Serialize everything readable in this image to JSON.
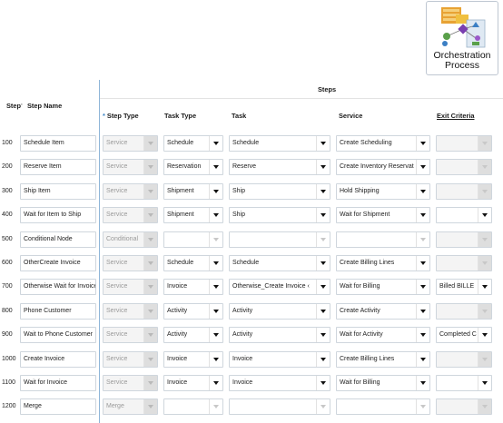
{
  "orchestration_icon": {
    "label_line1": "Orchestration",
    "label_line2": "Process",
    "icon": "orchestration-process-icon"
  },
  "headers": {
    "step": "Step",
    "step_mark": "'",
    "step_name": "Step Name",
    "group": "Steps",
    "required_marker": "*",
    "step_type": "Step Type",
    "task_type": "Task Type",
    "task": "Task",
    "service": "Service",
    "exit_criteria": "Exit Criteria"
  },
  "rows": [
    {
      "step": "100",
      "name": "Schedule Item",
      "step_type": "Service",
      "task_type": "Schedule",
      "task": "Schedule",
      "service": "Create Scheduling",
      "exit": ""
    },
    {
      "step": "200",
      "name": "Reserve Item",
      "step_type": "Service",
      "task_type": "Reservation",
      "task": "Reserve",
      "service": "Create Inventory Reservat",
      "exit": ""
    },
    {
      "step": "300",
      "name": "Ship Item",
      "step_type": "Service",
      "task_type": "Shipment",
      "task": "Ship",
      "service": "Hold Shipping",
      "exit": ""
    },
    {
      "step": "400",
      "name": "Wait for Item to Ship",
      "step_type": "Service",
      "task_type": "Shipment",
      "task": "Ship",
      "service": "Wait for Shipment",
      "exit": ""
    },
    {
      "step": "500",
      "name": "Conditional Node",
      "step_type": "Conditional",
      "task_type": "",
      "task": "",
      "service": "",
      "exit": ""
    },
    {
      "step": "600",
      "name": "OtherCreate Invoice",
      "step_type": "Service",
      "task_type": "Schedule",
      "task": "Schedule",
      "service": "Create Billing Lines",
      "exit": ""
    },
    {
      "step": "700",
      "name": "Otherwise Wait for Invoice",
      "step_type": "Service",
      "task_type": "Invoice",
      "task": "Otherwise_Create Invoice ‹",
      "service": "Wait for Billing",
      "exit": "Billed BILLE"
    },
    {
      "step": "800",
      "name": "Phone Customer",
      "step_type": "Service",
      "task_type": "Activity",
      "task": "Activity",
      "service": "Create Activity",
      "exit": ""
    },
    {
      "step": "900",
      "name": "Wait to Phone Customer",
      "step_type": "Service",
      "task_type": "Activity",
      "task": "Activity",
      "service": "Wait for Activity",
      "exit": "Completed C"
    },
    {
      "step": "1000",
      "name": "Create Invoice",
      "step_type": "Service",
      "task_type": "Invoice",
      "task": "Invoice",
      "service": "Create Billing Lines",
      "exit": ""
    },
    {
      "step": "1100",
      "name": "Wait for Invoice",
      "step_type": "Service",
      "task_type": "Invoice",
      "task": "Invoice",
      "service": "Wait for Billing",
      "exit": ""
    },
    {
      "step": "1200",
      "name": "Merge",
      "step_type": "Merge",
      "task_type": "",
      "task": "",
      "service": "",
      "exit": ""
    }
  ],
  "row_states": [
    {
      "dis": false,
      "exit_dis": true
    },
    {
      "dis": false,
      "exit_dis": true
    },
    {
      "dis": false,
      "exit_dis": true
    },
    {
      "dis": false,
      "exit_dis": false
    },
    {
      "dis": true,
      "exit_dis": true
    },
    {
      "dis": false,
      "exit_dis": true
    },
    {
      "dis": false,
      "exit_dis": false
    },
    {
      "dis": false,
      "exit_dis": true
    },
    {
      "dis": false,
      "exit_dis": false
    },
    {
      "dis": false,
      "exit_dis": true
    },
    {
      "dis": false,
      "exit_dis": false
    },
    {
      "dis": true,
      "exit_dis": true
    }
  ],
  "colors": {
    "separator": "#8fb6d8",
    "required": "#3d86c6",
    "readonly_bg": "#f4f4f4",
    "field_border": "#cfd6dd"
  }
}
